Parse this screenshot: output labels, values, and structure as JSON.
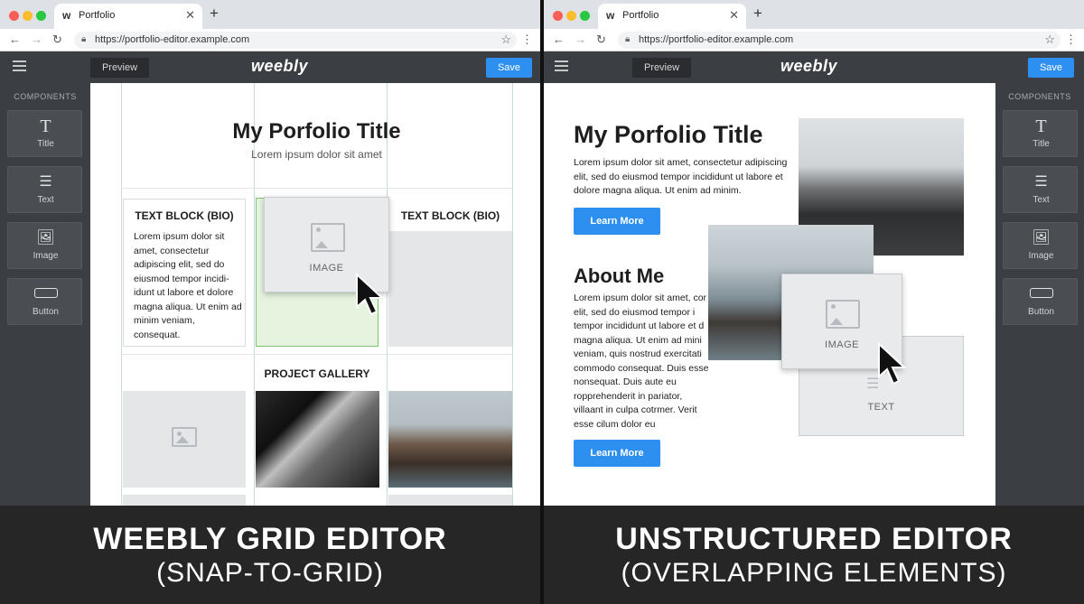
{
  "colors": {
    "accent": "#2d8ff0",
    "toolbar": "#3b3e42",
    "placeholder": "#e4e6e8",
    "grid_highlight": "#e5f3df"
  },
  "browser": {
    "tab_title": "Portfolio",
    "url": "https://portfolio-editor.example.com",
    "icons": [
      "back-arrow-icon",
      "forward-arrow-icon",
      "reload-icon",
      "lock-icon",
      "star-icon",
      "menu-dots-icon"
    ]
  },
  "editor": {
    "preview_label": "Preview",
    "logo_text": "weebly",
    "save_label": "Save",
    "components_title": "COMPONENTS",
    "components": [
      {
        "label": "Title",
        "icon": "title-T-icon"
      },
      {
        "label": "Text",
        "icon": "text-lines-icon"
      },
      {
        "label": "Image",
        "icon": "image-icon"
      },
      {
        "label": "Button",
        "icon": "button-icon"
      }
    ]
  },
  "left": {
    "title": "My Porfolio Title",
    "subtitle": "Lorem ipsum dolor sit amet",
    "bio_heading_1": "TEXT BLOCK (BIO)",
    "bio_text": "Lorem ipsum dolor sit amet, consectetur adipiscing elit, sed do eiusmod tempor incidi-idunt ut labore et dolore magna aliqua. Ut enim ad minim veniam, consequat.",
    "dragged_label": "IMAGE",
    "bio_heading_2": "TEXT BLOCK (BIO)",
    "gallery_heading": "PROJECT GALLERY"
  },
  "right": {
    "title": "My Porfolio Title",
    "intro_text": "Lorem ipsum dolor sit amet, consectetur adipiscing elit, sed do eiusmod tempor incididunt ut labore et dolore magna aliqua. Ut enim ad minim.",
    "learn_more_1": "Learn More",
    "about_heading": "About Me",
    "about_text": "Lorem ipsum dolor sit amet, cor elit, sed do eiusmod tempor i tempor incididunt ut labore et d magna aliqua. Ut enim ad mini veniam, quis nostrud exercitati commodo consequat. Duis esse nonsequat. Duis aute eu ropprehenderit in pariator, villaant in culpa cotrmer. Verit esse cilum dolor eu roprehenderit, non mouirrit anim id est laborum.",
    "image_card_label": "IMAGE",
    "text_card_label": "TEXT",
    "learn_more_2": "Learn More"
  },
  "captions": {
    "left_main": "WEEBLY GRID EDITOR",
    "left_sub": "(SNAP-TO-GRID)",
    "right_main": "UNSTRUCTURED EDITOR",
    "right_sub": "(OVERLAPPING ELEMENTS)"
  }
}
